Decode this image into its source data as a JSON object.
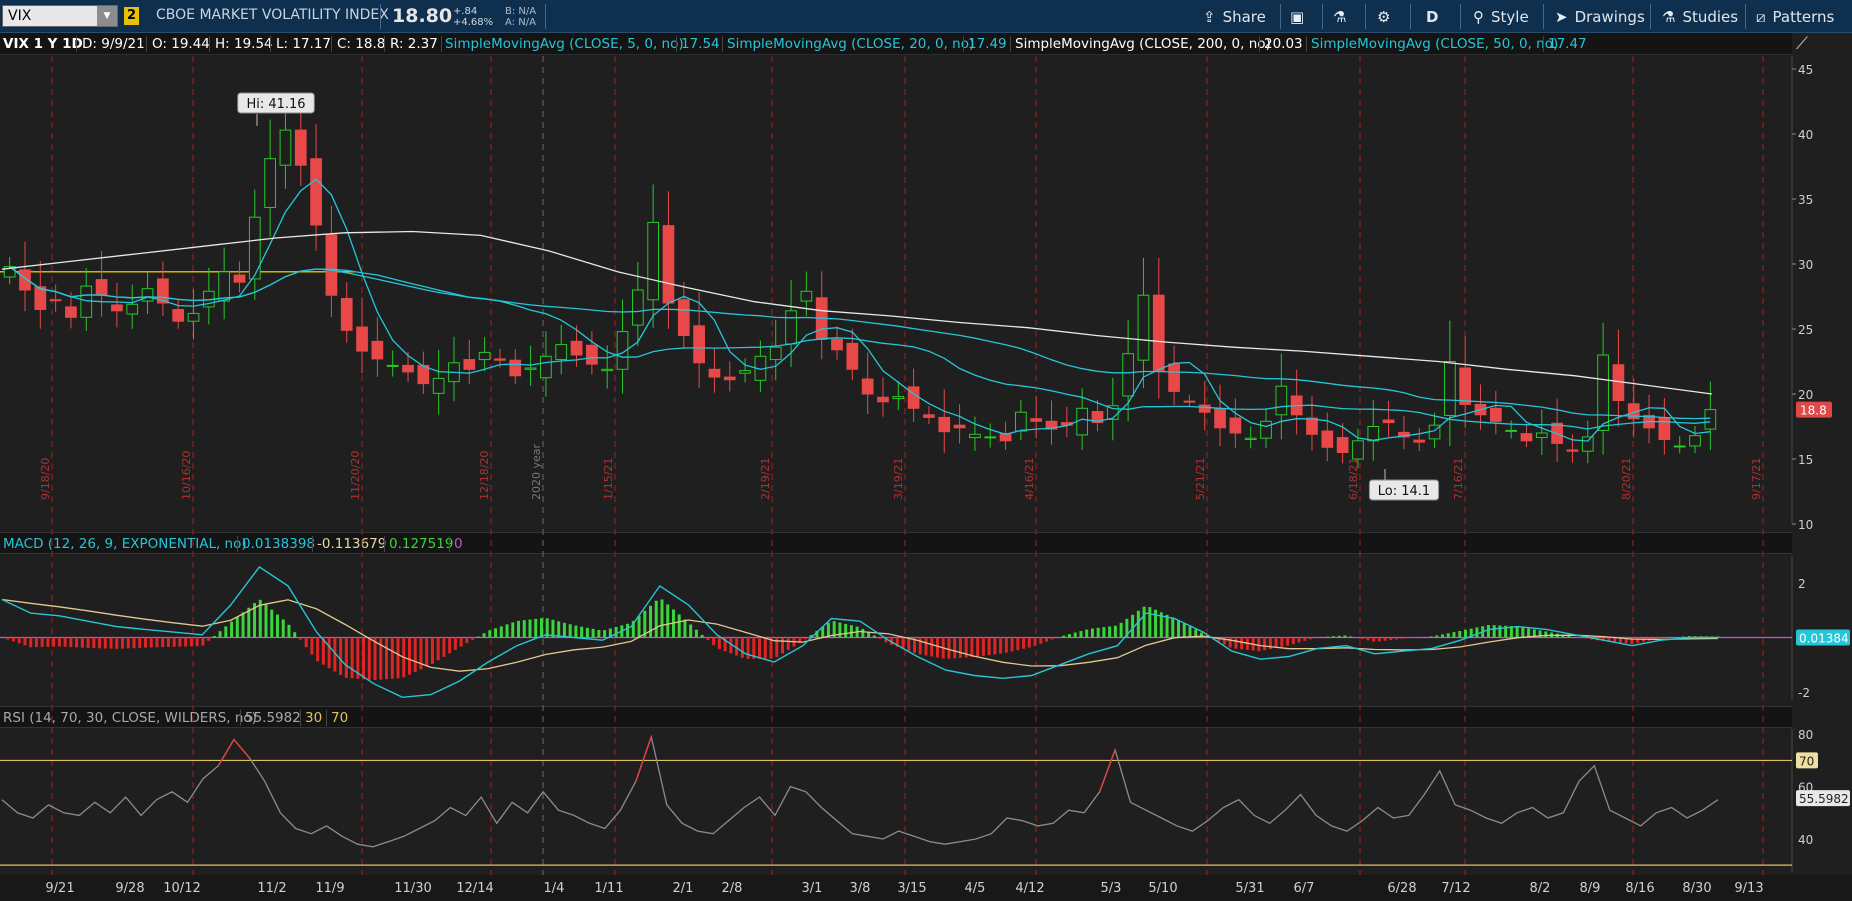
{
  "toolbar": {
    "symbol": "VIX",
    "link_badge": "2",
    "description": "CBOE MARKET VOLATILITY INDEX",
    "last": "18.80",
    "change": "+.84",
    "change_pct": "+4.68%",
    "bid": "B: N/A",
    "ask": "A: N/A",
    "share": "Share",
    "aggregation": "D",
    "style": "Style",
    "drawings": "Drawings",
    "studies": "Studies",
    "patterns": "Patterns",
    "colors": {
      "bg": "#0f2f4f",
      "badge": "#e6c200"
    }
  },
  "header": {
    "symbol_period": "VIX 1 Y 1D",
    "date": "D: 9/9/21",
    "open": "O: 19.44",
    "high": "H: 19.54",
    "low": "L: 17.17",
    "close": "C: 18.8",
    "range": "R: 2.37",
    "sma5_label": "SimpleMovingAvg (CLOSE, 5, 0, no)",
    "sma5_val": "17.54",
    "sma20_label": "SimpleMovingAvg (CLOSE, 20, 0, no)",
    "sma20_val": "17.49",
    "sma200_label": "SimpleMovingAvg (CLOSE, 200, 0, no)",
    "sma200_val": "20.03",
    "sma50_label": "SimpleMovingAvg (CLOSE, 50, 0, no)",
    "sma50_val": "17.47"
  },
  "macd_header": {
    "label": "MACD (12, 26, 9, EXPONENTIAL, no)",
    "value": "0.0138398",
    "avg": "-0.113679",
    "diff": "0.127519",
    "zero": "0"
  },
  "rsi_header": {
    "label": "RSI (14, 70, 30, CLOSE, WILDERS, no)",
    "value": "55.5982",
    "os": "30",
    "ob": "70"
  },
  "chart_data": [
    {
      "type": "candlestick",
      "title": "VIX 1 Y 1D",
      "ylim": [
        10,
        46
      ],
      "yticks": [
        "45",
        "40",
        "35",
        "30",
        "25",
        "20",
        "15",
        "10"
      ],
      "x": [
        "9/21",
        "9/28",
        "10/12",
        "11/2",
        "11/9",
        "11/30",
        "12/14",
        "1/4",
        "1/11",
        "2/1",
        "2/8",
        "3/1",
        "3/8",
        "3/15",
        "4/5",
        "4/12",
        "5/3",
        "5/10",
        "5/31",
        "6/7",
        "6/28",
        "7/12",
        "8/2",
        "8/9",
        "8/16",
        "8/30",
        "9/13"
      ],
      "expiration_labels": [
        "9/18/20",
        "10/16/20",
        "11/20/20",
        "12/18/20",
        "2020 year",
        "1/15/21",
        "2/19/21",
        "3/19/21",
        "4/16/21",
        "5/21/21",
        "6/18/21",
        "7/16/21",
        "8/20/21",
        "9/17/21"
      ],
      "high_label": "Hi: 41.16",
      "low_label": "Lo: 14.1",
      "last_label": "18.8",
      "close": [
        29.8,
        28.0,
        26.5,
        27.2,
        25.9,
        28.3,
        27.6,
        26.4,
        26.9,
        28.1,
        27.0,
        25.6,
        26.2,
        27.9,
        29.4,
        28.6,
        33.6,
        38.1,
        40.3,
        37.6,
        33.0,
        27.6,
        24.9,
        23.3,
        22.7,
        22.2,
        21.7,
        20.8,
        21.2,
        22.4,
        21.9,
        23.2,
        22.6,
        21.4,
        22.0,
        22.9,
        23.8,
        23.0,
        22.3,
        21.9,
        24.8,
        28.0,
        33.2,
        27.0,
        24.5,
        22.4,
        21.3,
        21.1,
        21.8,
        22.9,
        23.6,
        26.4,
        27.9,
        24.2,
        23.4,
        21.9,
        20.0,
        19.4,
        19.8,
        18.9,
        18.2,
        17.1,
        17.4,
        16.9,
        16.7,
        16.4,
        18.6,
        17.9,
        17.3,
        17.6,
        18.9,
        17.8,
        19.1,
        23.1,
        27.6,
        21.8,
        20.2,
        19.4,
        18.6,
        17.4,
        17.0,
        16.6,
        17.9,
        20.6,
        18.4,
        16.9,
        15.9,
        15.5,
        16.4,
        17.5,
        17.8,
        16.7,
        16.3,
        17.6,
        22.5,
        19.2,
        18.4,
        17.9,
        17.2,
        16.4,
        17.0,
        16.2,
        15.6,
        16.7,
        23.0,
        19.5,
        18.1,
        17.4,
        16.5,
        16.0,
        16.8,
        18.8
      ],
      "series": [
        {
          "name": "SimpleMovingAvg (CLOSE, 5, 0, no)",
          "color": "#25c6d8",
          "last": 17.54
        },
        {
          "name": "SimpleMovingAvg (CLOSE, 20, 0, no)",
          "color": "#25c6d8",
          "last": 17.49
        },
        {
          "name": "SimpleMovingAvg (CLOSE, 50, 0, no)",
          "color": "#25c6d8",
          "last": 17.47
        },
        {
          "name": "SimpleMovingAvg (CLOSE, 200, 0, no)",
          "color": "#e8e8e8",
          "last": 20.03,
          "values": [
            29.6,
            30.2,
            30.8,
            31.4,
            32.0,
            32.4,
            32.5,
            32.2,
            31.0,
            29.4,
            28.2,
            27.1,
            26.4,
            26.0,
            25.5,
            25.1,
            24.5,
            24.0,
            23.6,
            23.3,
            22.9,
            22.5,
            21.9,
            21.4,
            20.7,
            20.0
          ]
        }
      ],
      "horizontal_line": {
        "value": 29.4,
        "color": "#d4b400"
      }
    },
    {
      "type": "histogram",
      "title": "MACD (12, 26, 9, EXPONENTIAL, no)",
      "ylim": [
        -2.3,
        3.0
      ],
      "yticks": [
        "2",
        "-2"
      ],
      "last_label": "0.01384",
      "macd": [
        1.4,
        0.9,
        0.8,
        0.6,
        0.4,
        0.3,
        0.2,
        0.1,
        1.2,
        2.6,
        1.9,
        0.2,
        -1.0,
        -1.7,
        -2.2,
        -2.1,
        -1.6,
        -0.9,
        -0.3,
        0.1,
        0.0,
        -0.1,
        0.4,
        1.9,
        1.2,
        0.1,
        -0.6,
        -0.9,
        -0.3,
        0.7,
        0.6,
        -0.1,
        -0.7,
        -1.2,
        -1.4,
        -1.5,
        -1.4,
        -1.0,
        -0.6,
        -0.3,
        0.9,
        0.7,
        0.2,
        -0.5,
        -0.8,
        -0.7,
        -0.4,
        -0.3,
        -0.6,
        -0.5,
        -0.4,
        -0.1,
        0.3,
        0.4,
        0.3,
        0.1,
        -0.1,
        -0.3,
        -0.1,
        0.0,
        0.0
      ],
      "colors": {
        "macd": "#25c6d8",
        "avg": "#e0c890",
        "pos": "#3bd43b",
        "neg": "#e02424",
        "zero": "#d050d0"
      }
    },
    {
      "type": "line",
      "title": "RSI (14, 70, 30, CLOSE, WILDERS, no)",
      "ylim": [
        27,
        82
      ],
      "yticks": [
        "80",
        "70",
        "60",
        "40"
      ],
      "overbought": 70,
      "oversold": 30,
      "last_label": "55.5982",
      "values": [
        55,
        50,
        48,
        53,
        50,
        49,
        54,
        50,
        56,
        49,
        55,
        58,
        54,
        63,
        68,
        78,
        71,
        62,
        50,
        44,
        42,
        45,
        41,
        38,
        37,
        39,
        41,
        44,
        47,
        52,
        49,
        56,
        46,
        54,
        50,
        58,
        51,
        49,
        46,
        44,
        51,
        62,
        79,
        53,
        46,
        43,
        42,
        47,
        52,
        56,
        49,
        60,
        58,
        52,
        47,
        42,
        41,
        40,
        43,
        41,
        39,
        38,
        39,
        40,
        42,
        48,
        47,
        45,
        46,
        51,
        50,
        58,
        74,
        54,
        51,
        48,
        45,
        43,
        47,
        52,
        55,
        49,
        46,
        51,
        57,
        49,
        45,
        43,
        47,
        52,
        48,
        49,
        57,
        66,
        53,
        51,
        48,
        46,
        50,
        52,
        48,
        50,
        62,
        68,
        51,
        48,
        45,
        50,
        52,
        48,
        51,
        55
      ],
      "colors": {
        "line": "#8c8c8c",
        "ob_line": "#e0c060",
        "over": "#e04040"
      }
    }
  ]
}
